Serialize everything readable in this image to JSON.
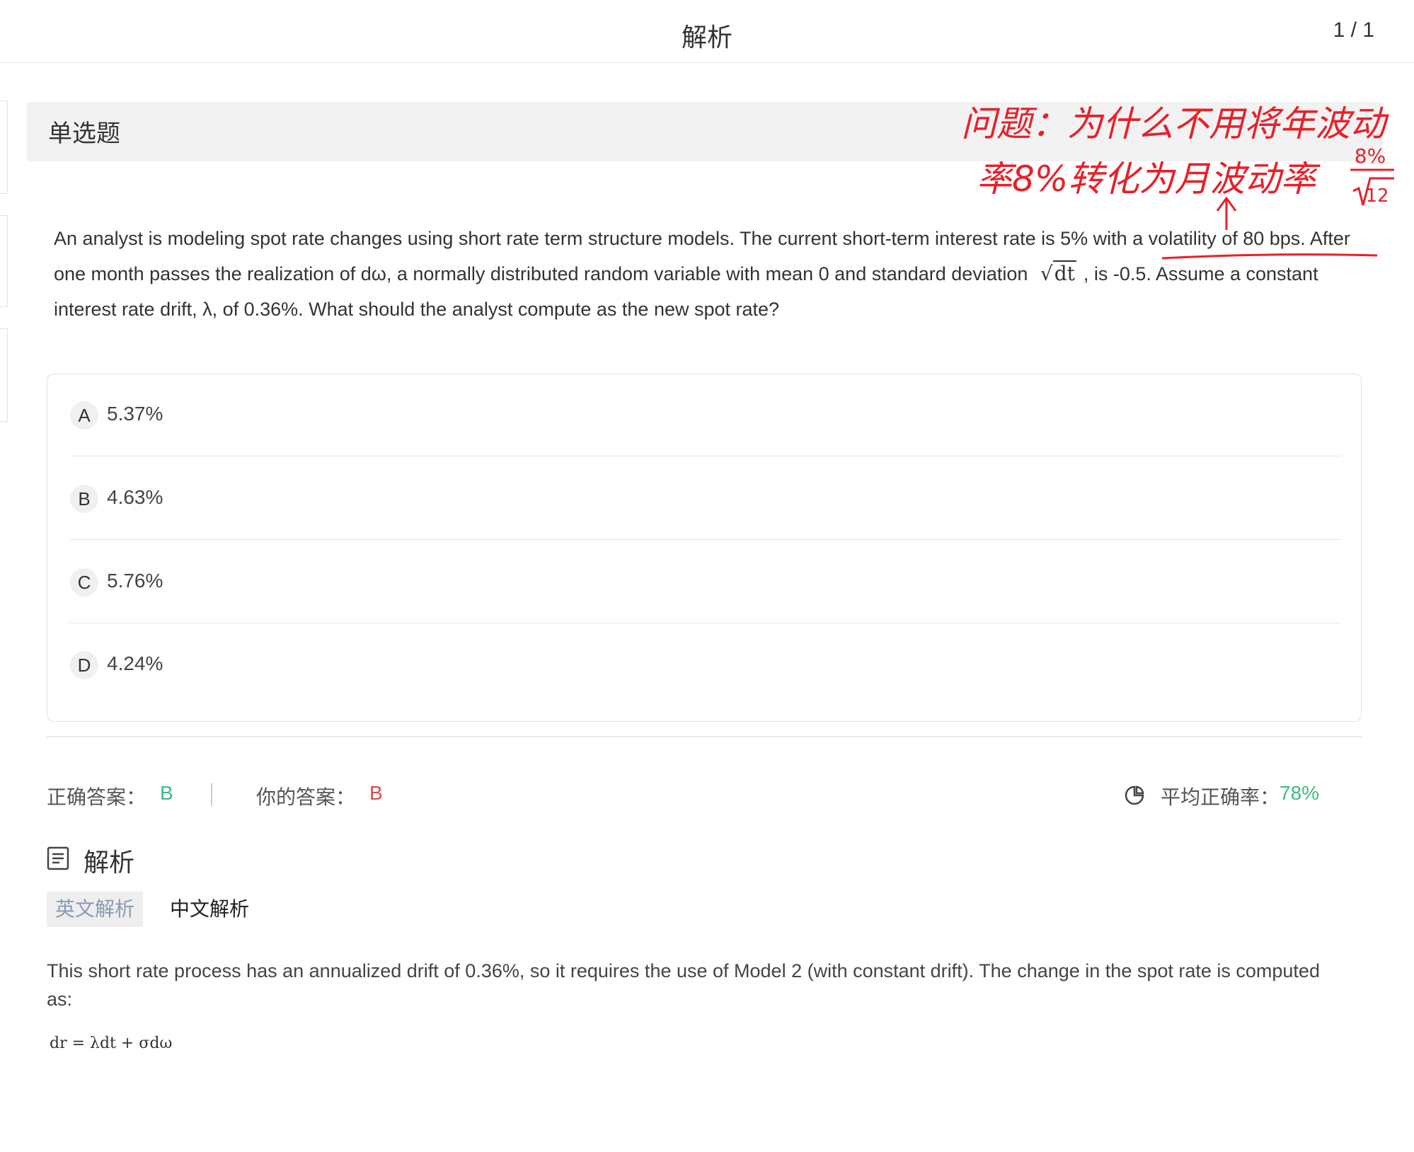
{
  "header": {
    "title": "解析",
    "counter": "1 / 1"
  },
  "question_type": "单选题",
  "annotation": {
    "lines": [
      "问题：为什么不用将年波动",
      "率8%转化为月波动率"
    ],
    "fraction_numerator": "8%",
    "fraction_denominator": "12",
    "color": "#e8202a"
  },
  "question": {
    "text_part1": "An analyst is modeling spot rate changes using short rate term structure models. The current short-term interest rate is 5% with a volatility of 80 bps. After one month passes the realization of dω, a normally distributed random variable with mean 0 and standard deviation ",
    "sqrt_symbol": "√",
    "sqrt_content": "dt",
    "text_part2": ", is -0.5. Assume a constant interest rate drift, λ, of 0.36%. What should the analyst compute as the new spot rate?"
  },
  "options": [
    {
      "letter": "A",
      "text": "5.37%"
    },
    {
      "letter": "B",
      "text": "4.63%"
    },
    {
      "letter": "C",
      "text": "5.76%"
    },
    {
      "letter": "D",
      "text": "4.24%"
    }
  ],
  "answers": {
    "correct_label": "正确答案：",
    "correct_value": "B",
    "yours_label": "你的答案：",
    "yours_value": "B",
    "avg_label": "平均正确率：",
    "avg_value": "78%",
    "stats_icon": "pie-chart-icon"
  },
  "analysis": {
    "title": "解析",
    "icon": "document-list-icon",
    "tabs": [
      "英文解析",
      "中文解析"
    ],
    "active_tab": "英文解析",
    "text": "This short rate process has an annualized drift of 0.36%, so it requires the use of Model 2 (with constant drift). The change in the spot rate is computed as:",
    "formula": "dr = λdt + σdω"
  },
  "colors": {
    "green": "#3dbb80",
    "red": "#d94b4b",
    "tab_active_text": "#8a9bb3"
  }
}
